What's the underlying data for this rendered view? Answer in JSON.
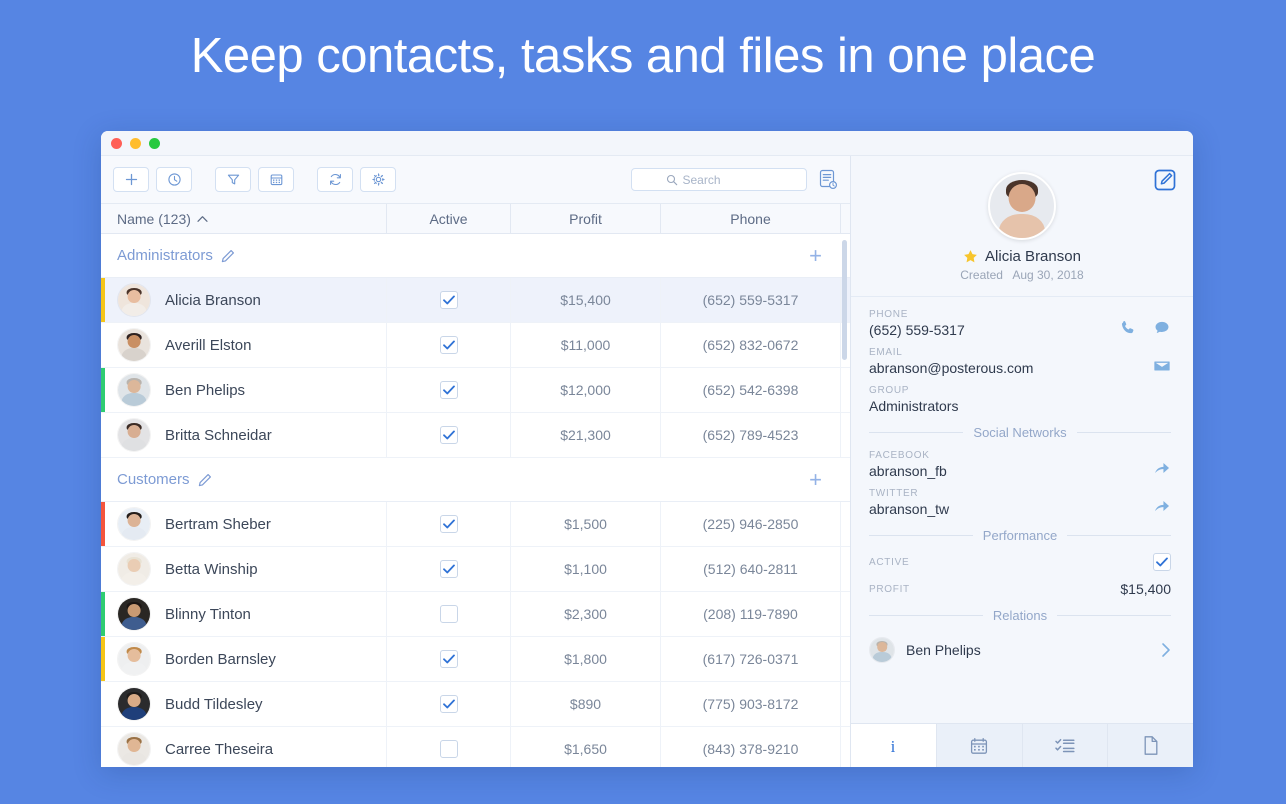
{
  "headline": "Keep contacts, tasks and files in one place",
  "window": {
    "traffic_lights": [
      "close",
      "minimize",
      "maximize"
    ]
  },
  "toolbar": {
    "buttons": [
      {
        "name": "add-button",
        "icon": "plus-icon"
      },
      {
        "name": "history-button",
        "icon": "clock-icon"
      },
      {
        "name": "filter-button",
        "icon": "funnel-icon"
      },
      {
        "name": "calendar-button",
        "icon": "calendar-icon"
      },
      {
        "name": "refresh-button",
        "icon": "refresh-icon"
      },
      {
        "name": "settings-button",
        "icon": "gear-icon"
      }
    ],
    "search": {
      "placeholder": "Search",
      "value": ""
    },
    "report_icon": "document-list-icon"
  },
  "table": {
    "columns": {
      "name": "Name (123)",
      "sort": "ascending",
      "active": "Active",
      "profit": "Profit",
      "phone": "Phone"
    },
    "groups": [
      {
        "title": "Administrators",
        "add_label": "+",
        "rows": [
          {
            "name": "Alicia Branson",
            "active": true,
            "profit": "$15,400",
            "phone": "(652) 559-5317",
            "stripe": "#f5c518",
            "selected": true,
            "avatar": {
              "skin": "#e8bda0",
              "hair": "#4a342a",
              "shirt": "#f2ede8",
              "bg": "#efe5dc"
            }
          },
          {
            "name": "Averill Elston",
            "active": true,
            "profit": "$11,000",
            "phone": "(652) 832-0672",
            "stripe": "",
            "selected": false,
            "avatar": {
              "skin": "#c98f63",
              "hair": "#2e2220",
              "shirt": "#d8d2cc",
              "bg": "#e9e3dd"
            }
          },
          {
            "name": "Ben Phelips",
            "active": true,
            "profit": "$12,000",
            "phone": "(652) 542-6398",
            "stripe": "#2ecc71",
            "selected": false,
            "avatar": {
              "skin": "#dcb79a",
              "hair": "#b9b3ad",
              "shirt": "#b9cbd8",
              "bg": "#dfe4e8"
            }
          },
          {
            "name": "Britta Schneidar",
            "active": true,
            "profit": "$21,300",
            "phone": "(652) 789-4523",
            "stripe": "",
            "selected": false,
            "avatar": {
              "skin": "#d8ae92",
              "hair": "#3a2a24",
              "shirt": "#dfe0e2",
              "bg": "#e3e3e5"
            }
          }
        ]
      },
      {
        "title": "Customers",
        "add_label": "+",
        "rows": [
          {
            "name": "Bertram Sheber",
            "active": true,
            "profit": "$1,500",
            "phone": "(225) 946-2850",
            "stripe": "#f4553d",
            "selected": false,
            "avatar": {
              "skin": "#dcb396",
              "hair": "#241d1a",
              "shirt": "#e4eaf2",
              "bg": "#e8eef5"
            }
          },
          {
            "name": "Betta Winship",
            "active": true,
            "profit": "$1,100",
            "phone": "(512) 640-2811",
            "stripe": "",
            "selected": false,
            "avatar": {
              "skin": "#eacdb4",
              "hair": "#e8e2d4",
              "shirt": "#f3efe9",
              "bg": "#f0ece6"
            }
          },
          {
            "name": "Blinny Tinton",
            "active": false,
            "profit": "$2,300",
            "phone": "(208) 119-7890",
            "stripe": "#2ecc71",
            "selected": false,
            "avatar": {
              "skin": "#c99a73",
              "hair": "#1c1614",
              "shirt": "#3f5d8f",
              "bg": "#2a2724"
            }
          },
          {
            "name": "Borden Barnsley",
            "active": true,
            "profit": "$1,800",
            "phone": "(617) 726-0371",
            "stripe": "#f5c518",
            "selected": false,
            "avatar": {
              "skin": "#e5bd9c",
              "hair": "#c08a4a",
              "shirt": "#f0f1f2",
              "bg": "#eeeff0"
            }
          },
          {
            "name": "Budd Tildesley",
            "active": true,
            "profit": "$890",
            "phone": "(775) 903-8172",
            "stripe": "",
            "selected": false,
            "avatar": {
              "skin": "#d9ab87",
              "hair": "#1f1b1a",
              "shirt": "#1f3f7a",
              "bg": "#2b2b2d"
            }
          },
          {
            "name": "Carree Theseira",
            "active": false,
            "profit": "$1,650",
            "phone": "(843) 378-9210",
            "stripe": "",
            "selected": false,
            "avatar": {
              "skin": "#e0b694",
              "hair": "#9a7246",
              "shirt": "#e9e6e2",
              "bg": "#ebe8e4"
            }
          }
        ]
      }
    ]
  },
  "detail": {
    "edit_icon": "edit-pencil-icon",
    "favorite_icon": "star-icon",
    "name": "Alicia Branson",
    "created_label": "Created",
    "created_date": "Aug 30, 2018",
    "fields": [
      {
        "label": "PHONE",
        "value": "(652) 559-5317",
        "actions": [
          "phone-icon",
          "chat-icon"
        ]
      },
      {
        "label": "EMAIL",
        "value": "abranson@posterous.com",
        "actions": [
          "envelope-icon"
        ]
      },
      {
        "label": "GROUP",
        "value": "Administrators",
        "actions": []
      }
    ],
    "social_divider": "Social Networks",
    "social": [
      {
        "label": "FACEBOOK",
        "value": "abranson_fb",
        "actions": [
          "share-arrow-icon"
        ]
      },
      {
        "label": "TWITTER",
        "value": "abranson_tw",
        "actions": [
          "share-arrow-icon"
        ]
      }
    ],
    "performance_divider": "Performance",
    "performance": [
      {
        "label": "ACTIVE",
        "value": "",
        "checkbox": true
      },
      {
        "label": "PROFIT",
        "value": "$15,400",
        "checkbox": false
      }
    ],
    "relations_divider": "Relations",
    "relations": [
      {
        "name": "Ben Phelips",
        "avatar": {
          "skin": "#dcb79a",
          "hair": "#b9b3ad",
          "shirt": "#b9cbd8",
          "bg": "#dfe4e8"
        }
      }
    ],
    "tabs": [
      {
        "name": "tab-info",
        "icon": "info-icon",
        "active": true
      },
      {
        "name": "tab-calendar",
        "icon": "calendar-icon",
        "active": false
      },
      {
        "name": "tab-tasks",
        "icon": "checklist-icon",
        "active": false
      },
      {
        "name": "tab-files",
        "icon": "document-icon",
        "active": false
      }
    ]
  },
  "colors": {
    "background": "#5685e3",
    "accent": "#3a7bd5",
    "icon_blue": "#7fb0e0",
    "panel_bg": "#f4f7fc"
  }
}
